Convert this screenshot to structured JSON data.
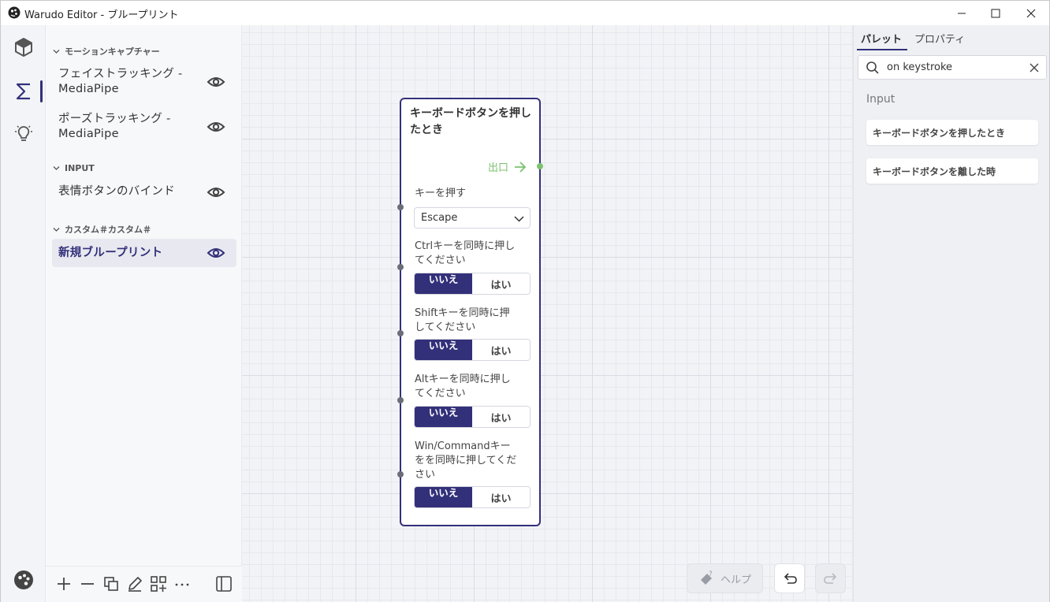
{
  "window": {
    "title": "Warudo Editor - ブループリント"
  },
  "activity_bar": {
    "items": [
      "scene-icon",
      "blueprint-sigma-icon",
      "lightbulb-icon"
    ],
    "active": "blueprint-sigma-icon",
    "bottom": "settings-palette-icon"
  },
  "left_panel": {
    "sections": [
      {
        "header": "モーションキャプチャー",
        "items": [
          {
            "label": "フェイストラッキング - MediaPipe"
          },
          {
            "label": "ポーズトラッキング - MediaPipe"
          }
        ]
      },
      {
        "header": "INPUT",
        "items": [
          {
            "label": "表情ボタンのバインド"
          }
        ]
      },
      {
        "header": "カスタム＃カスタム＃",
        "items": [
          {
            "label": "新規ブループリント",
            "selected": true
          }
        ]
      }
    ],
    "toolbar": [
      "add-icon",
      "remove-icon",
      "duplicate-icon",
      "edit-icon",
      "add-grid-icon",
      "more-icon",
      "panel-toggle-icon"
    ]
  },
  "node": {
    "title": "キーボードボタンを押したとき",
    "exit_label": "出口",
    "key_label": "キーを押す",
    "key_value": "Escape",
    "ctrl_label": "Ctrlキーを同時に押してください",
    "shift_label": "Shiftキーを同時に押してください",
    "alt_label": "Altキーを同時に押してください",
    "win_label": "Win/Commandキーをを同時に押してください",
    "no": "いいえ",
    "yes": "はい"
  },
  "canvas_controls": {
    "help_label": "ヘルプ"
  },
  "right_panel": {
    "tabs": [
      "パレット",
      "プロパティ"
    ],
    "active_tab": "パレット",
    "search_value": "on keystroke",
    "category": "Input",
    "results": [
      "キーボードボタンを押したとき",
      "キーボードボタンを離した時"
    ]
  },
  "colors": {
    "accent": "#33307a",
    "exit_green": "#7cc26e"
  }
}
